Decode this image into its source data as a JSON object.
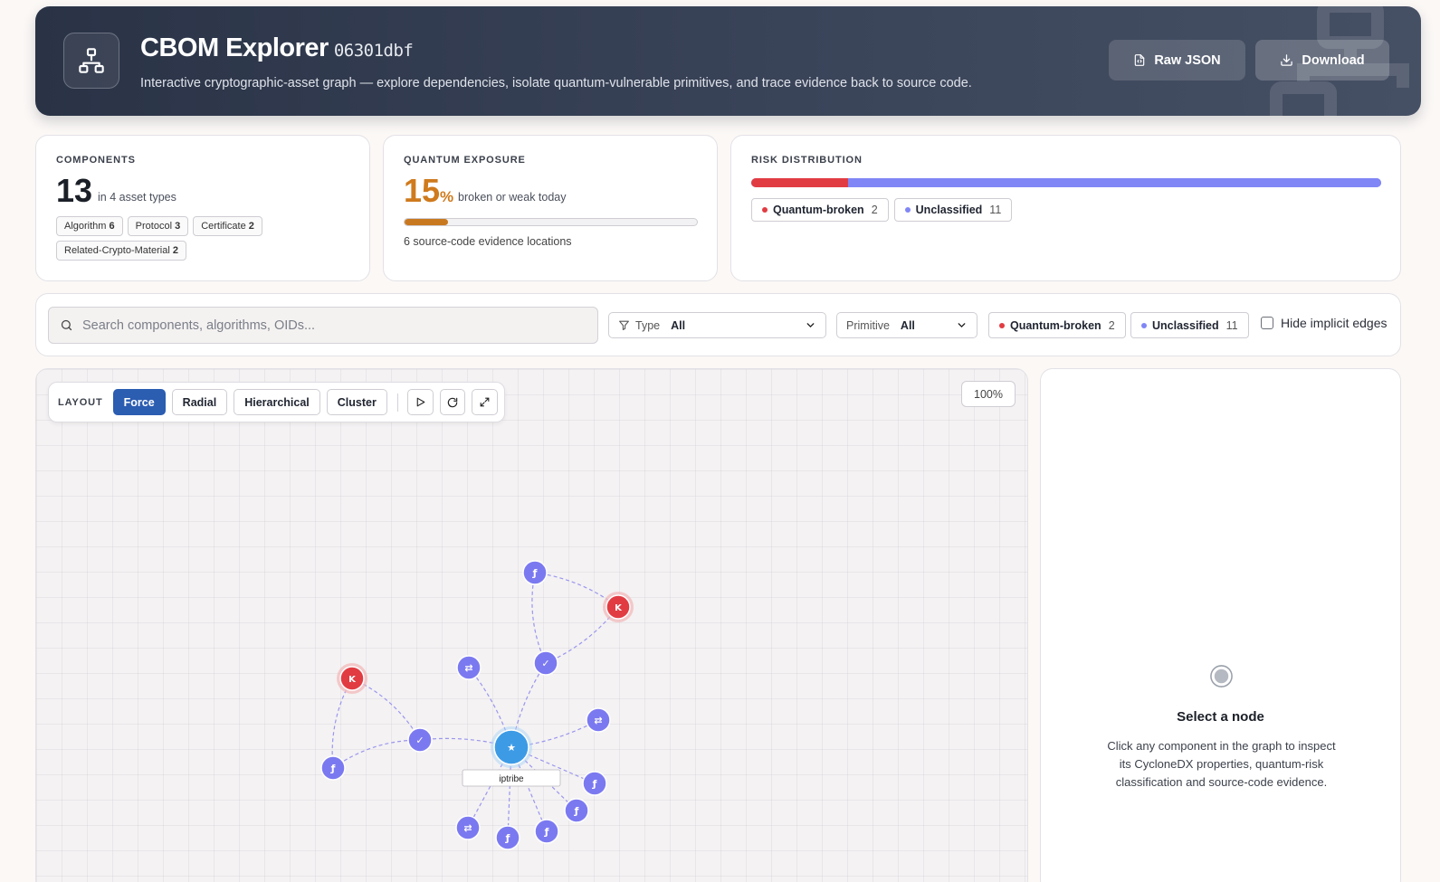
{
  "header": {
    "title": "CBOM Explorer",
    "hash": "06301dbf",
    "subtitle": "Interactive cryptographic-asset graph — explore dependencies, isolate quantum-vulnerable primitives, and trace evidence back to source code.",
    "raw_json_label": "Raw JSON",
    "download_label": "Download"
  },
  "components": {
    "label": "COMPONENTS",
    "count": "13",
    "sub": "in 4 asset types",
    "types": [
      {
        "name": "Algorithm",
        "count": "6"
      },
      {
        "name": "Protocol",
        "count": "3"
      },
      {
        "name": "Certificate",
        "count": "2"
      },
      {
        "name": "Related-Crypto-Material",
        "count": "2"
      }
    ]
  },
  "quantum": {
    "label": "QUANTUM EXPOSURE",
    "value": "15",
    "unit": "%",
    "sub": "broken or weak today",
    "progress": 0.15,
    "evidence": "6 source-code evidence locations"
  },
  "risk": {
    "label": "RISK DISTRIBUTION",
    "broken_fraction": 0.154,
    "categories": [
      {
        "name": "Quantum-broken",
        "count": "2",
        "color": "#e13c42"
      },
      {
        "name": "Unclassified",
        "count": "11",
        "color": "#8086f5"
      }
    ]
  },
  "filters": {
    "search_placeholder": "Search components, algorithms, OIDs...",
    "type_label": "Type",
    "type_value": "All",
    "primitive_label": "Primitive",
    "primitive_value": "All",
    "hide_implicit": "Hide implicit edges"
  },
  "graph": {
    "layout_label": "LAYOUT",
    "layouts": [
      "Force",
      "Radial",
      "Hierarchical",
      "Cluster"
    ],
    "active_layout": "Force",
    "zoom": "100%",
    "root_label": "iptribe",
    "colors": {
      "broken": "#e13c42",
      "unclassified": "#7b79f0",
      "root": "#3d9be6",
      "edge": "#8a86ec"
    }
  },
  "detail": {
    "title": "Select a node",
    "description": "Click any component in the graph to inspect its CycloneDX properties, quantum-risk classification and source-code evidence."
  }
}
